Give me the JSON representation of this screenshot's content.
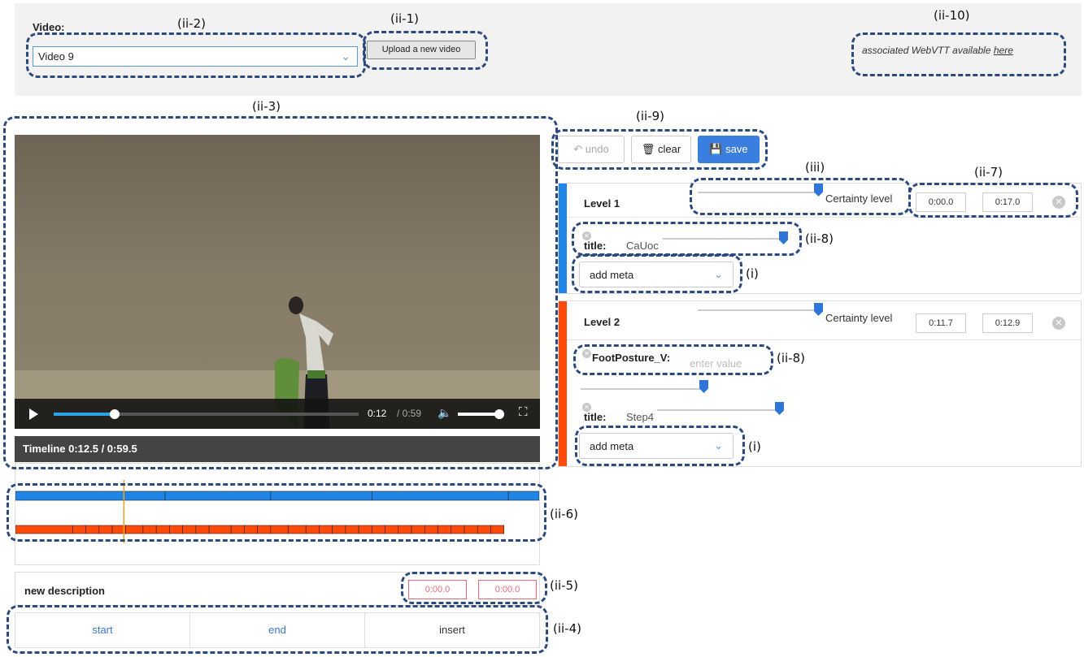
{
  "top_bar": {
    "video_label": "Video:",
    "video_selected": "Video 9",
    "upload_button": "Upload a new video",
    "webvtt_text": "associated WebVTT available ",
    "webvtt_link": "here"
  },
  "player": {
    "current_time": "0:12",
    "total_time": "/ 0:59",
    "progress_fraction": 0.2
  },
  "timeline": {
    "header": "Timeline 0:12.5 / 0:59.5",
    "playhead_time": 12.5,
    "duration": 59.5,
    "colors": {
      "level1": "#1f86e8",
      "level2": "#ff4a0a",
      "playhead": "#f0a020"
    },
    "level1_bounds": [
      0.0,
      17.0,
      29.0,
      40.5,
      56.0,
      59.5
    ],
    "level2_bounds": [
      0.0,
      6.5,
      8.0,
      9.5,
      11.0,
      12.5,
      14.5,
      16.0,
      17.5,
      19.0,
      20.5,
      22.0,
      24.5,
      26.0,
      27.5,
      29.0,
      31.0,
      33.0,
      34.5,
      36.0,
      37.5,
      39.0,
      40.5,
      42.0,
      43.5,
      45.0,
      46.5,
      48.0,
      49.5,
      51.0,
      52.5,
      54.0,
      55.5
    ]
  },
  "new_description": {
    "title": "new description",
    "start_value": "0:00.0",
    "end_value": "0:00.0"
  },
  "actions": {
    "start": "start",
    "end": "end",
    "insert": "insert"
  },
  "toolbar": {
    "undo": "undo",
    "clear": "clear",
    "save": "save"
  },
  "levels": [
    {
      "title": "Level 1",
      "certainty_label": "Certainty level",
      "certainty_fraction": 0.95,
      "start": "0:00.0",
      "end": "0:17.0",
      "meta": [
        {
          "key": "title:",
          "value": "CaUoc",
          "certainty_fraction": 0.95
        }
      ],
      "add_meta": "add meta"
    },
    {
      "title": "Level 2",
      "certainty_label": "Certainty level",
      "certainty_fraction": 0.95,
      "start": "0:11.7",
      "end": "0:12.9",
      "meta": [
        {
          "key": "FootPosture_V:",
          "placeholder": "enter value",
          "certainty_fraction": 0.95
        },
        {
          "key": "title:",
          "value": "Step4",
          "certainty_fraction": 0.95
        }
      ],
      "add_meta": "add meta"
    }
  ],
  "annotation_tags": {
    "ii1": "(ii-1)",
    "ii2": "(ii-2)",
    "ii3": "(ii-3)",
    "ii4": "(ii-4)",
    "ii5": "(ii-5)",
    "ii6": "(ii-6)",
    "ii7": "(ii-7)",
    "ii8a": "(ii-8)",
    "ii8b": "(ii-8)",
    "ii9": "(ii-9)",
    "ii10": "(ii-10)",
    "iii": "(iii)",
    "ia": "(i)",
    "ib": "(i)"
  }
}
